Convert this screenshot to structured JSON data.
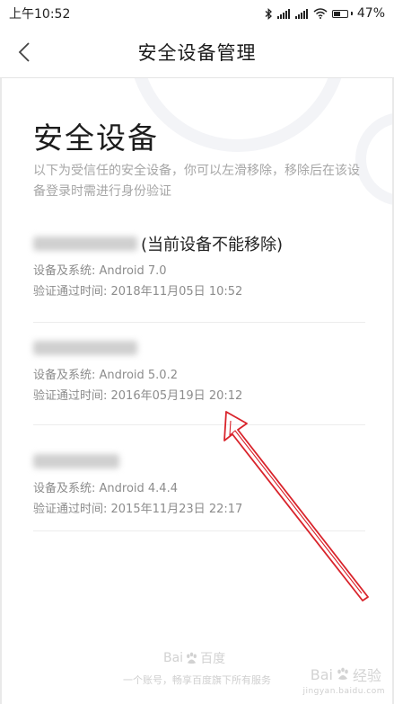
{
  "status_bar": {
    "time": "上午10:52",
    "battery": "47%",
    "battery_level": 0.47,
    "icons": [
      "bluetooth-icon",
      "signal-icon",
      "signal-icon",
      "wifi-icon",
      "battery-icon"
    ]
  },
  "nav": {
    "title": "安全设备管理",
    "back_icon": "chevron-left-icon"
  },
  "page": {
    "title": "安全设备",
    "description": "以下为受信任的安全设备，你可以左滑移除，移除后在该设备登录时需进行身份验证"
  },
  "devices": [
    {
      "name_suffix": "(当前设备不能移除)",
      "system": "设备及系统: Android 7.0",
      "verified": "验证通过时间: 2018年11月05日 10:52"
    },
    {
      "name_suffix": "",
      "system": "设备及系统: Android 5.0.2",
      "verified": "验证通过时间: 2016年05月19日 20:12"
    },
    {
      "name_suffix": "",
      "system": "设备及系统: Android 4.4.4",
      "verified": "验证通过时间: 2015年11月23日 22:17"
    }
  ],
  "footer": {
    "logo_text": "百度",
    "slogan": "一个账号，畅享百度旗下所有服务"
  },
  "watermark": {
    "text": "Bai",
    "text_cn": "经验",
    "sub": "jingyan.baidu.com"
  },
  "colors": {
    "annotation_arrow": "#d9232b",
    "muted_text": "#a6a6a6"
  }
}
